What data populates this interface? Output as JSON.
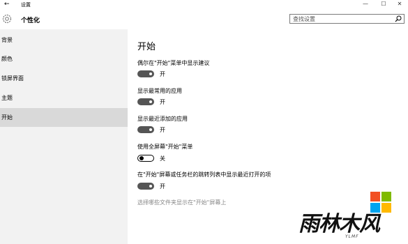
{
  "window": {
    "back_glyph": "←",
    "title": "设置",
    "minimize": "—",
    "maximize": "☐",
    "close": "✕"
  },
  "header": {
    "section_title": "个性化",
    "search_placeholder": "查找设置"
  },
  "sidebar": {
    "items": [
      {
        "label": "背景"
      },
      {
        "label": "颜色"
      },
      {
        "label": "锁屏界面"
      },
      {
        "label": "主题"
      },
      {
        "label": "开始"
      }
    ],
    "active_index": 4
  },
  "main": {
    "title": "开始",
    "settings": [
      {
        "label": "偶尔在\"开始\"菜单中显示建议",
        "state": "开",
        "on": true
      },
      {
        "label": "显示最常用的应用",
        "state": "开",
        "on": true
      },
      {
        "label": "显示最近添加的应用",
        "state": "开",
        "on": true
      },
      {
        "label": "使用全屏幕\"开始\"菜单",
        "state": "关",
        "on": false
      },
      {
        "label": "在\"开始\"屏幕或任务栏的跳转列表中显示最近打开的项",
        "state": "开",
        "on": true
      }
    ],
    "link": "选择哪些文件夹显示在\"开始\"屏幕上"
  },
  "watermark": {
    "text": "雨林木风",
    "sub": "YLMF",
    "colors": [
      "#f25022",
      "#7fba00",
      "#00a4ef",
      "#ffb900"
    ]
  }
}
